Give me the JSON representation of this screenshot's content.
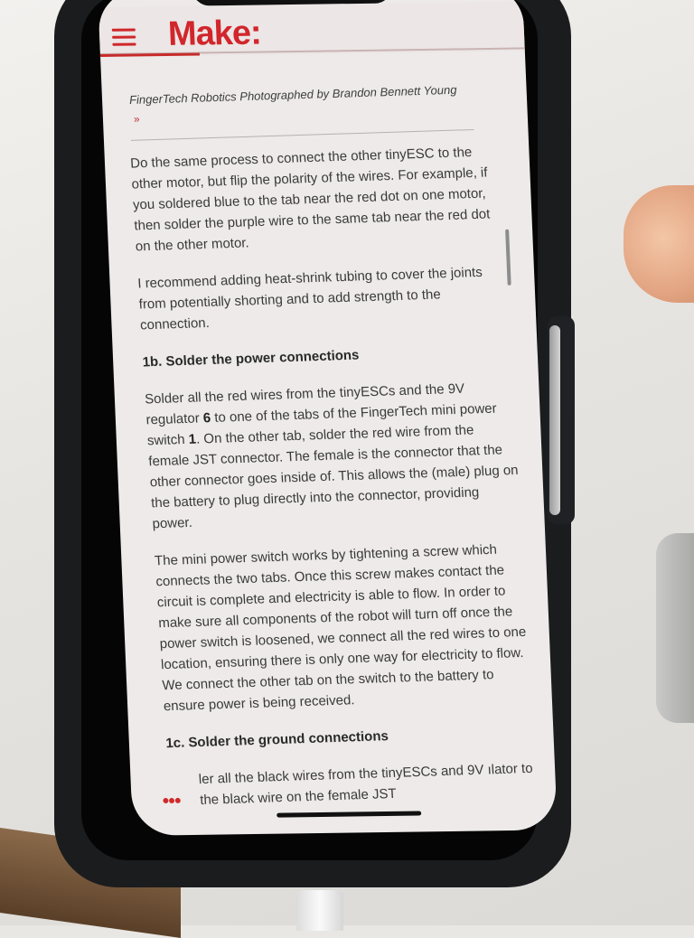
{
  "brand": {
    "logo_text": "Make:",
    "accent": "#d1262b"
  },
  "caption": {
    "text": "FingerTech Robotics Photographed by Brandon Bennett Young",
    "arrow": "»"
  },
  "article": {
    "paragraphs": [
      {
        "type": "p",
        "text": "Do the same process to connect the other tinyESC to the other motor, but flip the polarity of the wires. For example, if you soldered blue to the tab near the red dot on one motor, then solder the purple wire to the same tab near the red dot on the other motor."
      },
      {
        "type": "p",
        "text": "I recommend adding heat-shrink tubing to cover the joints from potentially shorting and to add strength to the connection."
      },
      {
        "type": "h",
        "text": "1b. Solder the power connections"
      },
      {
        "type": "p_rich",
        "part1": "Solder all the red wires from the tinyESCs and the 9V regulator ",
        "bold1": "6",
        "part2": " to one of the tabs of the FingerTech mini power switch ",
        "bold2": "1",
        "part3": ". On the other tab, solder the red wire from the female JST connector. The female is the connector that the other connector goes inside of. This allows the (male) plug on the battery to plug directly into the connector, providing power."
      },
      {
        "type": "p",
        "text": "The mini power switch works by tightening a screw which connects the two tabs. Once this screw makes contact the circuit is complete and electricity is able to flow. In order to make sure all components of the robot will turn off once the power switch is loosened, we connect all the red wires to one location, ensuring there is only one way for electricity to flow. We connect the other tab on the switch to the battery to ensure power is being received."
      },
      {
        "type": "h",
        "text": "1c. Solder the ground connections"
      },
      {
        "type": "p",
        "text": "ler all the black wires from the tinyESCs and 9V ılator to the black wire on the female JST"
      }
    ]
  },
  "ui": {
    "more_dots": "•••"
  }
}
